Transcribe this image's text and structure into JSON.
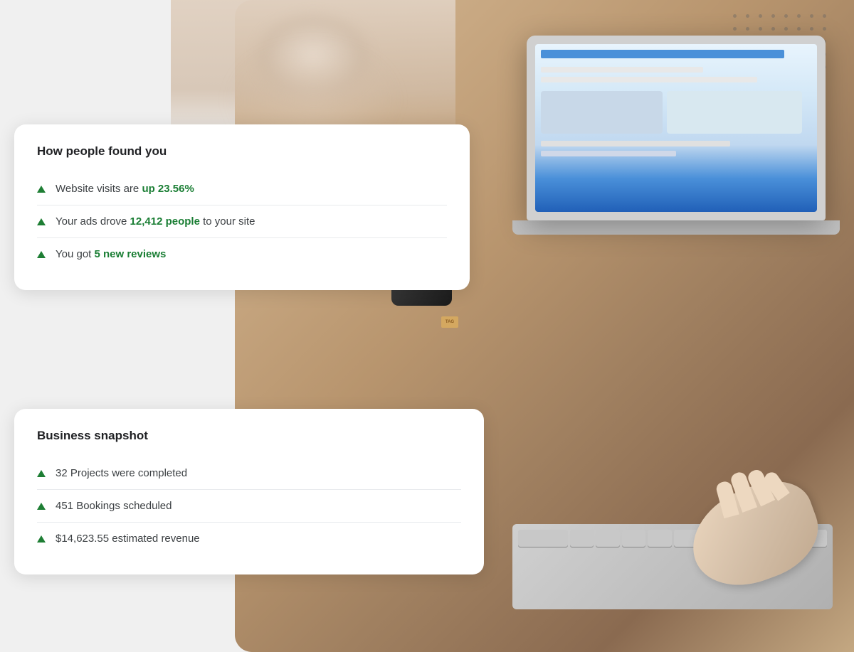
{
  "scene": {
    "card1": {
      "title": "How people found you",
      "items": [
        {
          "text_before": "Website visits are ",
          "highlight": "up 23.56%",
          "text_after": ""
        },
        {
          "text_before": "Your ads drove ",
          "highlight": "12,412 people",
          "text_after": " to your site"
        },
        {
          "text_before": "You got ",
          "highlight": "5 new reviews",
          "text_after": ""
        }
      ]
    },
    "card2": {
      "title": "Business snapshot",
      "items": [
        {
          "text_before": "32 Projects were completed",
          "highlight": "",
          "text_after": ""
        },
        {
          "text_before": "451 Bookings scheduled",
          "highlight": "",
          "text_after": ""
        },
        {
          "text_before": "$14,623.55 estimated revenue",
          "highlight": "",
          "text_after": ""
        }
      ]
    }
  },
  "colors": {
    "green_highlight": "#1a7e34",
    "card_bg": "#ffffff",
    "text_primary": "#202124",
    "text_secondary": "#3c4043",
    "divider": "#e8eaed"
  }
}
